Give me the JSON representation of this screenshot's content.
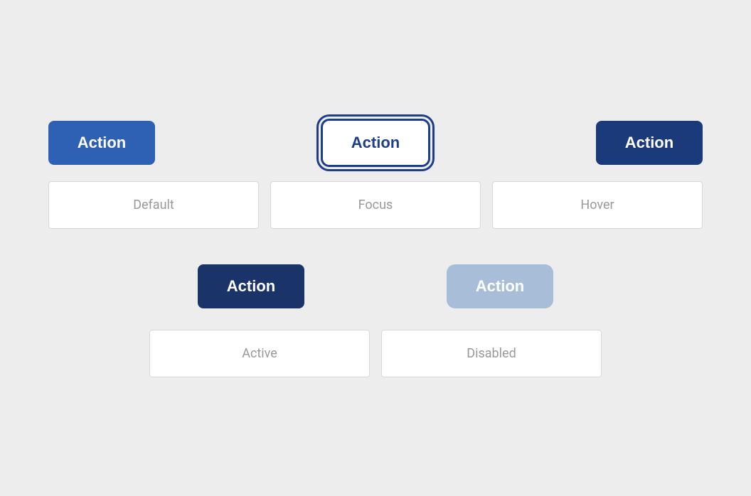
{
  "page": {
    "background": "#EDEDED"
  },
  "row1": {
    "btn_default_label": "Action",
    "btn_focus_label": "Action",
    "btn_hover_label": "Action"
  },
  "row2": {
    "label_default": "Default",
    "label_focus": "Focus",
    "label_hover": "Hover"
  },
  "row3": {
    "btn_active_label": "Action",
    "btn_disabled_label": "Action"
  },
  "row4": {
    "label_active": "Active",
    "label_disabled": "Disabled"
  }
}
